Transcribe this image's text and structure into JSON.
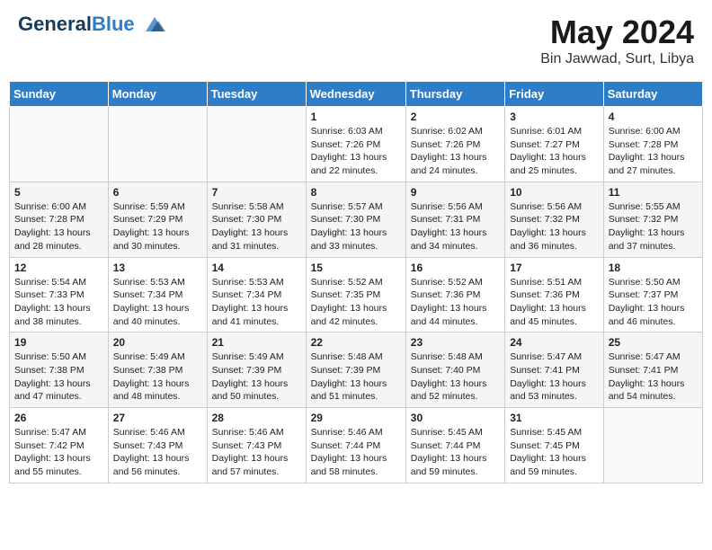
{
  "header": {
    "logo_line1": "General",
    "logo_line2": "Blue",
    "month": "May 2024",
    "location": "Bin Jawwad, Surt, Libya"
  },
  "weekdays": [
    "Sunday",
    "Monday",
    "Tuesday",
    "Wednesday",
    "Thursday",
    "Friday",
    "Saturday"
  ],
  "weeks": [
    [
      {
        "day": "",
        "sunrise": "",
        "sunset": "",
        "daylight": ""
      },
      {
        "day": "",
        "sunrise": "",
        "sunset": "",
        "daylight": ""
      },
      {
        "day": "",
        "sunrise": "",
        "sunset": "",
        "daylight": ""
      },
      {
        "day": "1",
        "sunrise": "Sunrise: 6:03 AM",
        "sunset": "Sunset: 7:26 PM",
        "daylight": "Daylight: 13 hours and 22 minutes."
      },
      {
        "day": "2",
        "sunrise": "Sunrise: 6:02 AM",
        "sunset": "Sunset: 7:26 PM",
        "daylight": "Daylight: 13 hours and 24 minutes."
      },
      {
        "day": "3",
        "sunrise": "Sunrise: 6:01 AM",
        "sunset": "Sunset: 7:27 PM",
        "daylight": "Daylight: 13 hours and 25 minutes."
      },
      {
        "day": "4",
        "sunrise": "Sunrise: 6:00 AM",
        "sunset": "Sunset: 7:28 PM",
        "daylight": "Daylight: 13 hours and 27 minutes."
      }
    ],
    [
      {
        "day": "5",
        "sunrise": "Sunrise: 6:00 AM",
        "sunset": "Sunset: 7:28 PM",
        "daylight": "Daylight: 13 hours and 28 minutes."
      },
      {
        "day": "6",
        "sunrise": "Sunrise: 5:59 AM",
        "sunset": "Sunset: 7:29 PM",
        "daylight": "Daylight: 13 hours and 30 minutes."
      },
      {
        "day": "7",
        "sunrise": "Sunrise: 5:58 AM",
        "sunset": "Sunset: 7:30 PM",
        "daylight": "Daylight: 13 hours and 31 minutes."
      },
      {
        "day": "8",
        "sunrise": "Sunrise: 5:57 AM",
        "sunset": "Sunset: 7:30 PM",
        "daylight": "Daylight: 13 hours and 33 minutes."
      },
      {
        "day": "9",
        "sunrise": "Sunrise: 5:56 AM",
        "sunset": "Sunset: 7:31 PM",
        "daylight": "Daylight: 13 hours and 34 minutes."
      },
      {
        "day": "10",
        "sunrise": "Sunrise: 5:56 AM",
        "sunset": "Sunset: 7:32 PM",
        "daylight": "Daylight: 13 hours and 36 minutes."
      },
      {
        "day": "11",
        "sunrise": "Sunrise: 5:55 AM",
        "sunset": "Sunset: 7:32 PM",
        "daylight": "Daylight: 13 hours and 37 minutes."
      }
    ],
    [
      {
        "day": "12",
        "sunrise": "Sunrise: 5:54 AM",
        "sunset": "Sunset: 7:33 PM",
        "daylight": "Daylight: 13 hours and 38 minutes."
      },
      {
        "day": "13",
        "sunrise": "Sunrise: 5:53 AM",
        "sunset": "Sunset: 7:34 PM",
        "daylight": "Daylight: 13 hours and 40 minutes."
      },
      {
        "day": "14",
        "sunrise": "Sunrise: 5:53 AM",
        "sunset": "Sunset: 7:34 PM",
        "daylight": "Daylight: 13 hours and 41 minutes."
      },
      {
        "day": "15",
        "sunrise": "Sunrise: 5:52 AM",
        "sunset": "Sunset: 7:35 PM",
        "daylight": "Daylight: 13 hours and 42 minutes."
      },
      {
        "day": "16",
        "sunrise": "Sunrise: 5:52 AM",
        "sunset": "Sunset: 7:36 PM",
        "daylight": "Daylight: 13 hours and 44 minutes."
      },
      {
        "day": "17",
        "sunrise": "Sunrise: 5:51 AM",
        "sunset": "Sunset: 7:36 PM",
        "daylight": "Daylight: 13 hours and 45 minutes."
      },
      {
        "day": "18",
        "sunrise": "Sunrise: 5:50 AM",
        "sunset": "Sunset: 7:37 PM",
        "daylight": "Daylight: 13 hours and 46 minutes."
      }
    ],
    [
      {
        "day": "19",
        "sunrise": "Sunrise: 5:50 AM",
        "sunset": "Sunset: 7:38 PM",
        "daylight": "Daylight: 13 hours and 47 minutes."
      },
      {
        "day": "20",
        "sunrise": "Sunrise: 5:49 AM",
        "sunset": "Sunset: 7:38 PM",
        "daylight": "Daylight: 13 hours and 48 minutes."
      },
      {
        "day": "21",
        "sunrise": "Sunrise: 5:49 AM",
        "sunset": "Sunset: 7:39 PM",
        "daylight": "Daylight: 13 hours and 50 minutes."
      },
      {
        "day": "22",
        "sunrise": "Sunrise: 5:48 AM",
        "sunset": "Sunset: 7:39 PM",
        "daylight": "Daylight: 13 hours and 51 minutes."
      },
      {
        "day": "23",
        "sunrise": "Sunrise: 5:48 AM",
        "sunset": "Sunset: 7:40 PM",
        "daylight": "Daylight: 13 hours and 52 minutes."
      },
      {
        "day": "24",
        "sunrise": "Sunrise: 5:47 AM",
        "sunset": "Sunset: 7:41 PM",
        "daylight": "Daylight: 13 hours and 53 minutes."
      },
      {
        "day": "25",
        "sunrise": "Sunrise: 5:47 AM",
        "sunset": "Sunset: 7:41 PM",
        "daylight": "Daylight: 13 hours and 54 minutes."
      }
    ],
    [
      {
        "day": "26",
        "sunrise": "Sunrise: 5:47 AM",
        "sunset": "Sunset: 7:42 PM",
        "daylight": "Daylight: 13 hours and 55 minutes."
      },
      {
        "day": "27",
        "sunrise": "Sunrise: 5:46 AM",
        "sunset": "Sunset: 7:43 PM",
        "daylight": "Daylight: 13 hours and 56 minutes."
      },
      {
        "day": "28",
        "sunrise": "Sunrise: 5:46 AM",
        "sunset": "Sunset: 7:43 PM",
        "daylight": "Daylight: 13 hours and 57 minutes."
      },
      {
        "day": "29",
        "sunrise": "Sunrise: 5:46 AM",
        "sunset": "Sunset: 7:44 PM",
        "daylight": "Daylight: 13 hours and 58 minutes."
      },
      {
        "day": "30",
        "sunrise": "Sunrise: 5:45 AM",
        "sunset": "Sunset: 7:44 PM",
        "daylight": "Daylight: 13 hours and 59 minutes."
      },
      {
        "day": "31",
        "sunrise": "Sunrise: 5:45 AM",
        "sunset": "Sunset: 7:45 PM",
        "daylight": "Daylight: 13 hours and 59 minutes."
      },
      {
        "day": "",
        "sunrise": "",
        "sunset": "",
        "daylight": ""
      }
    ]
  ]
}
